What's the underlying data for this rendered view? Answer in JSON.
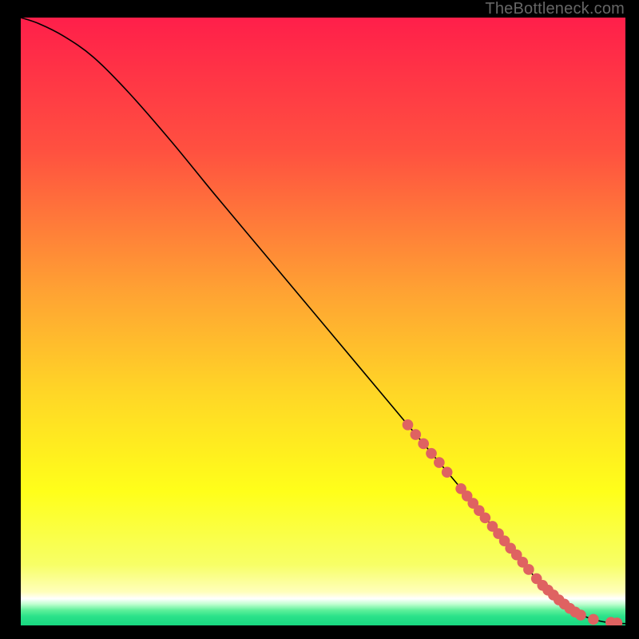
{
  "attribution": "TheBottleneck.com",
  "chart_data": {
    "type": "line",
    "title": "",
    "xlabel": "",
    "ylabel": "",
    "xlim": [
      0,
      100
    ],
    "ylim": [
      0,
      100
    ],
    "grid": false,
    "gradient_stops": [
      {
        "offset": 0.0,
        "color": "#ff1f4a"
      },
      {
        "offset": 0.22,
        "color": "#ff5140"
      },
      {
        "offset": 0.45,
        "color": "#ffa233"
      },
      {
        "offset": 0.62,
        "color": "#ffd726"
      },
      {
        "offset": 0.78,
        "color": "#ffff1a"
      },
      {
        "offset": 0.9,
        "color": "#f7ff66"
      },
      {
        "offset": 0.945,
        "color": "#ffffbb"
      },
      {
        "offset": 0.956,
        "color": "#ffffff"
      },
      {
        "offset": 0.965,
        "color": "#c0ffd0"
      },
      {
        "offset": 0.975,
        "color": "#5ef09a"
      },
      {
        "offset": 0.985,
        "color": "#2be28a"
      },
      {
        "offset": 1.0,
        "color": "#18d880"
      }
    ],
    "series": [
      {
        "name": "curve",
        "x": [
          0,
          3,
          7,
          12,
          18,
          25,
          32,
          40,
          48,
          56,
          64,
          72,
          78,
          82,
          85,
          88,
          91,
          94,
          97,
          100
        ],
        "y": [
          100,
          99,
          97,
          93.5,
          87.5,
          79.5,
          71,
          61.5,
          52,
          42.5,
          33,
          23.5,
          16.3,
          11.5,
          8,
          5,
          2.7,
          1.2,
          0.5,
          0.3
        ]
      }
    ],
    "markers": {
      "color": "#df6261",
      "radius_pct": 0.9,
      "points": [
        {
          "x": 64.0,
          "y": 33.0
        },
        {
          "x": 65.3,
          "y": 31.4
        },
        {
          "x": 66.6,
          "y": 29.9
        },
        {
          "x": 67.9,
          "y": 28.3
        },
        {
          "x": 69.2,
          "y": 26.8
        },
        {
          "x": 70.5,
          "y": 25.2
        },
        {
          "x": 72.8,
          "y": 22.5
        },
        {
          "x": 73.8,
          "y": 21.3
        },
        {
          "x": 74.8,
          "y": 20.1
        },
        {
          "x": 75.8,
          "y": 18.9
        },
        {
          "x": 76.8,
          "y": 17.7
        },
        {
          "x": 78.0,
          "y": 16.3
        },
        {
          "x": 79.0,
          "y": 15.1
        },
        {
          "x": 80.0,
          "y": 13.9
        },
        {
          "x": 81.0,
          "y": 12.7
        },
        {
          "x": 82.0,
          "y": 11.6
        },
        {
          "x": 83.0,
          "y": 10.4
        },
        {
          "x": 84.0,
          "y": 9.2
        },
        {
          "x": 85.3,
          "y": 7.7
        },
        {
          "x": 86.3,
          "y": 6.6
        },
        {
          "x": 87.2,
          "y": 5.8
        },
        {
          "x": 88.1,
          "y": 5.0
        },
        {
          "x": 89.0,
          "y": 4.2
        },
        {
          "x": 89.9,
          "y": 3.5
        },
        {
          "x": 90.8,
          "y": 2.8
        },
        {
          "x": 91.7,
          "y": 2.2
        },
        {
          "x": 92.6,
          "y": 1.7
        },
        {
          "x": 94.7,
          "y": 1.0
        },
        {
          "x": 97.6,
          "y": 0.5
        },
        {
          "x": 98.6,
          "y": 0.4
        }
      ]
    }
  }
}
